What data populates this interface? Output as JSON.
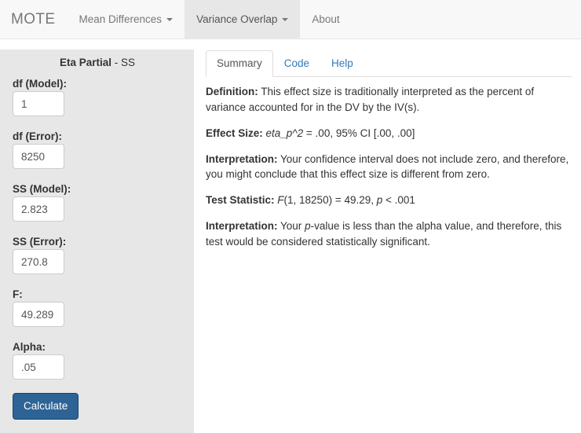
{
  "navbar": {
    "brand": "MOTE",
    "items": [
      {
        "label": "Mean Differences",
        "has_caret": true,
        "active": false
      },
      {
        "label": "Variance Overlap",
        "has_caret": true,
        "active": true
      },
      {
        "label": "About",
        "has_caret": false,
        "active": false
      }
    ]
  },
  "sidebar": {
    "title_bold": "Eta Partial",
    "title_light": " - SS",
    "fields": [
      {
        "label": "df (Model):",
        "value": "1"
      },
      {
        "label": "df (Error):",
        "value": "8250"
      },
      {
        "label": "SS (Model):",
        "value": "2.823"
      },
      {
        "label": "SS (Error):",
        "value": "270.8"
      },
      {
        "label": "F:",
        "value": "49.289"
      },
      {
        "label": "Alpha:",
        "value": ".05"
      }
    ],
    "calculate_label": "Calculate"
  },
  "main": {
    "tabs": [
      {
        "label": "Summary",
        "active": true
      },
      {
        "label": "Code",
        "active": false
      },
      {
        "label": "Help",
        "active": false
      }
    ],
    "paragraphs": [
      {
        "lead": "Definition:",
        "text": " This effect size is traditionally interpreted as the percent of variance accounted for in the DV by the IV(s)."
      },
      {
        "lead": "Effect Size:",
        "italic": " eta_p^2",
        "text": " = .00, 95% CI [.00, .00]"
      },
      {
        "lead": "Interpretation:",
        "text": " Your confidence interval does not include zero, and therefore, you might conclude that this effect size is different from zero."
      },
      {
        "lead": "Test Statistic:",
        "italic": " F",
        "text": "(1, 18250) = 49.29, ",
        "italic2": "p",
        "text2": " < .001"
      },
      {
        "lead": "Interpretation:",
        "text": " Your ",
        "italic2": "p",
        "text2": "-value is less than the alpha value, and therefore, this test would be considered statistically significant."
      }
    ]
  },
  "colors": {
    "navbar_bg": "#f8f8f8",
    "sidebar_bg": "#e7e7e7",
    "button_bg": "#2d6395",
    "link": "#337ab7"
  }
}
